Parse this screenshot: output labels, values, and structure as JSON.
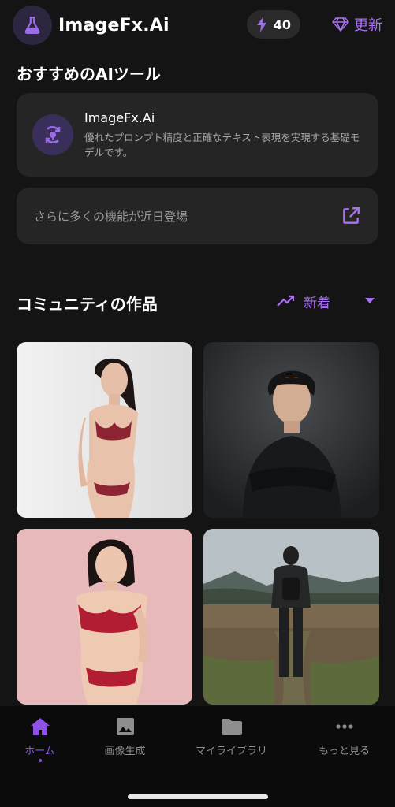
{
  "header": {
    "app_title": "ImageFx.Ai",
    "credits": "40",
    "upgrade_label": "更新"
  },
  "recommended": {
    "title": "おすすめのAIツール",
    "tool_name": "ImageFx.Ai",
    "tool_desc": "優れたプロンプト精度と正確なテキスト表現を実現する基礎モデルです。",
    "coming_soon": "さらに多くの機能が近日登場"
  },
  "community": {
    "title": "コミュニティの作品",
    "sort_label": "新着"
  },
  "tabs": [
    {
      "label": "ホーム"
    },
    {
      "label": "画像生成"
    },
    {
      "label": "マイライブラリ"
    },
    {
      "label": "もっと見る"
    }
  ],
  "colors": {
    "accent": "#a970f0",
    "background": "#141414",
    "card": "#252525"
  }
}
